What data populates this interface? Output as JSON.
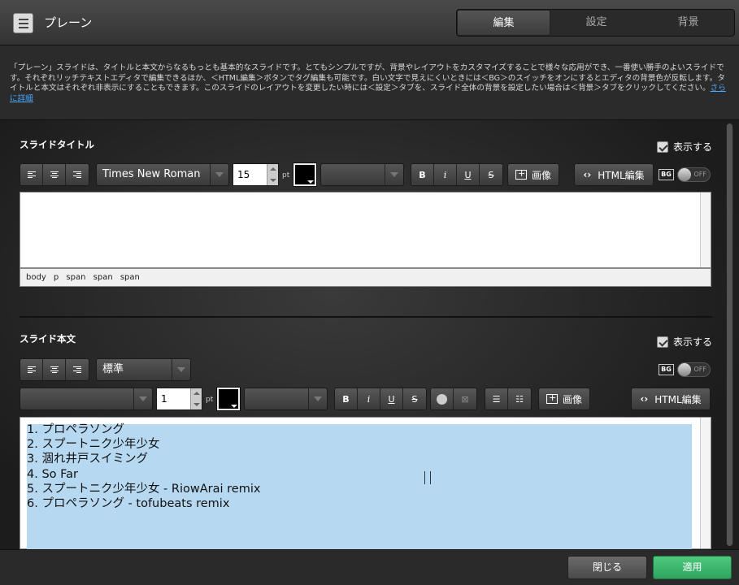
{
  "header": {
    "title": "プレーン"
  },
  "tabs": [
    {
      "label": "編集"
    },
    {
      "label": "設定"
    },
    {
      "label": "背景"
    }
  ],
  "description": {
    "text": "「プレーン」スライドは、タイトルと本文からなるもっとも基本的なスライドです。とてもシンプルですが、背景やレイアウトをカスタマイズすることで様々な応用ができ、一番使い勝手のよいスライドです。それぞれリッチテキストエディタで編集できるほか、＜HTML編集＞ボタンでタグ編集も可能です。白い文字で見えにくいときには＜BG＞のスイッチをオンにするとエディタの背景色が反転します。タイトルと本文はそれぞれ非表示にすることもできます。このスライドのレイアウトを変更したい時には＜設定＞タブを、スライド全体の背景を設定したい場合は＜背景＞タブをクリックしてください。",
    "link": "さらに詳細"
  },
  "title_section": {
    "label": "スライドタイトル",
    "show_label": "表示する",
    "font": "Times New Roman",
    "size": "15",
    "pt": "pt",
    "bold": "B",
    "italic": "i",
    "underline": "U",
    "strike": "S",
    "image_label": "画像",
    "html_label": "HTML編集",
    "bg_tag": "BG",
    "toggle_state": "OFF",
    "path": "body p span span span"
  },
  "body_section": {
    "label": "スライド本文",
    "show_label": "表示する",
    "style": "標準",
    "font": "",
    "size": "1",
    "pt": "pt",
    "bold": "B",
    "italic": "i",
    "underline": "U",
    "strike": "S",
    "image_label": "画像",
    "html_label": "HTML編集",
    "bg_tag": "BG",
    "toggle_state": "OFF",
    "lines": [
      "1. プロペラソング",
      "2. スプートニク少年少女",
      "3. 涸れ井戸スイミング",
      "4. So Far",
      "5. スプートニク少年少女 - RiowArai remix",
      "6. プロペラソング - tofubeats remix"
    ]
  },
  "footer": {
    "close": "閉じる",
    "apply": "適用"
  },
  "colors": {
    "accent": "#3bb36b",
    "link": "#4aa8ff",
    "selection": "#b6d8f0"
  }
}
